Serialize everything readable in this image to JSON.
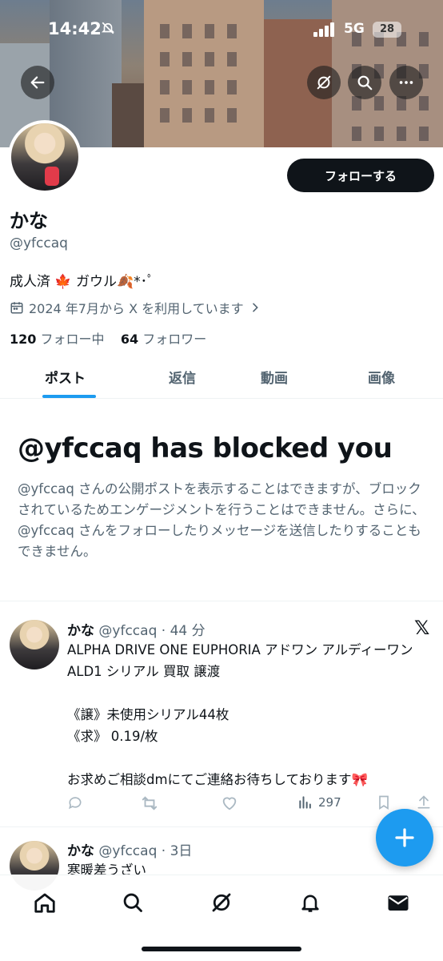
{
  "status_bar": {
    "time": "14:42",
    "network": "5G",
    "battery": "28"
  },
  "profile": {
    "name": "かな",
    "handle": "@yfccaq",
    "bio": "成人済 🍁 ガウル🍂*･ﾟ",
    "joined": "2024 年7月から X を利用しています",
    "following_count": "120",
    "following_label": "フォロー中",
    "followers_count": "64",
    "followers_label": "フォロワー",
    "follow_button": "フォローする"
  },
  "tabs": [
    "ポスト",
    "返信",
    "動画",
    "画像"
  ],
  "blocked": {
    "title": "@yfccaq has blocked you",
    "description": "@yfccaq さんの公開ポストを表示することはできますが、ブロックされているためエンゲージメントを行うことはできません。さらに、@yfccaq さんをフォローしたりメッセージを送信したりすることもできません。"
  },
  "posts": [
    {
      "name": "かな",
      "meta": "@yfccaq · 44 分",
      "text": "ALPHA DRIVE ONE EUPHORIA アドワン アルディーワン ALD1 シリアル 買取 譲渡\n\n《譲》未使用シリアル44枚\n《求》 0.19/枚\n\nお求めご相談dmにてご連絡お待ちしております🎀",
      "views": "297"
    },
    {
      "name": "かな",
      "meta": "@yfccaq · 3日",
      "text": "寒暖差うざい"
    }
  ],
  "icons": {
    "back": "arrow-left-icon",
    "grok": "grok-icon",
    "search": "search-icon",
    "more": "more-icon",
    "calendar": "calendar-icon",
    "reply": "reply-icon",
    "repost": "repost-icon",
    "like": "heart-icon",
    "views": "views-icon",
    "bookmark": "bookmark-icon",
    "share": "share-icon",
    "compose": "plus-icon",
    "home": "home-icon",
    "notifications": "bell-icon",
    "messages": "mail-icon"
  },
  "colors": {
    "accent": "#1d9bf0",
    "text": "#0f1419",
    "secondary": "#536471"
  }
}
